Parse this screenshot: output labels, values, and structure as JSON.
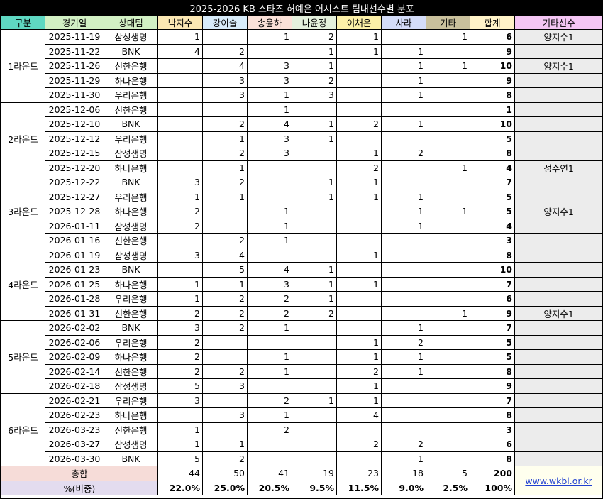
{
  "title": "2025-2026 KB 스타즈 허예은 어시스트 팀내선수별 분포",
  "headers": [
    {
      "label": "구분",
      "bg": "#5fd8c2"
    },
    {
      "label": "경기일",
      "bg": "#d2f0c4"
    },
    {
      "label": "상대팀",
      "bg": "#d2f0c4"
    },
    {
      "label": "박지수",
      "bg": "#fbe7b3"
    },
    {
      "label": "강이슬",
      "bg": "#d8ecfa"
    },
    {
      "label": "송윤하",
      "bg": "#fbe1d8"
    },
    {
      "label": "나윤정",
      "bg": "#e4f0dc"
    },
    {
      "label": "이채은",
      "bg": "#fcf0a8"
    },
    {
      "label": "사라",
      "bg": "#d4dcf8"
    },
    {
      "label": "기타",
      "bg": "#c9c09c"
    },
    {
      "label": "합계",
      "bg": "#fff3c8"
    },
    {
      "label": "기타선수",
      "bg": "#f4c6f4"
    }
  ],
  "rounds": [
    {
      "label": "1라운드",
      "games": [
        {
          "date": "2025-11-19",
          "opp": "삼성생명",
          "v": [
            "1",
            "",
            "1",
            "2",
            "1",
            "",
            "1"
          ],
          "total": "6",
          "other": "양지수1"
        },
        {
          "date": "2025-11-22",
          "opp": "BNK",
          "v": [
            "4",
            "2",
            "",
            "1",
            "1",
            "1",
            ""
          ],
          "total": "9",
          "other": ""
        },
        {
          "date": "2025-11-26",
          "opp": "신한은행",
          "v": [
            "",
            "4",
            "3",
            "1",
            "",
            "1",
            "1"
          ],
          "total": "10",
          "other": "양지수1"
        },
        {
          "date": "2025-11-29",
          "opp": "하나은행",
          "v": [
            "",
            "3",
            "3",
            "2",
            "",
            "1",
            ""
          ],
          "total": "9",
          "other": ""
        },
        {
          "date": "2025-11-30",
          "opp": "우리은행",
          "v": [
            "",
            "3",
            "1",
            "3",
            "",
            "1",
            ""
          ],
          "total": "8",
          "other": ""
        }
      ]
    },
    {
      "label": "2라운드",
      "games": [
        {
          "date": "2025-12-06",
          "opp": "신한은행",
          "v": [
            "",
            "",
            "1",
            "",
            "",
            "",
            ""
          ],
          "total": "1",
          "other": ""
        },
        {
          "date": "2025-12-10",
          "opp": "BNK",
          "v": [
            "",
            "2",
            "4",
            "1",
            "2",
            "1",
            ""
          ],
          "total": "10",
          "other": ""
        },
        {
          "date": "2025-12-12",
          "opp": "우리은행",
          "v": [
            "",
            "1",
            "3",
            "1",
            "",
            "",
            ""
          ],
          "total": "5",
          "other": ""
        },
        {
          "date": "2025-12-15",
          "opp": "삼성생명",
          "v": [
            "",
            "2",
            "3",
            "",
            "1",
            "2",
            ""
          ],
          "total": "8",
          "other": ""
        },
        {
          "date": "2025-12-20",
          "opp": "하나은행",
          "v": [
            "",
            "1",
            "",
            "",
            "2",
            "",
            "1"
          ],
          "total": "4",
          "other": "성수연1"
        }
      ]
    },
    {
      "label": "3라운드",
      "games": [
        {
          "date": "2025-12-22",
          "opp": "BNK",
          "v": [
            "3",
            "2",
            "",
            "1",
            "1",
            "",
            ""
          ],
          "total": "7",
          "other": ""
        },
        {
          "date": "2025-12-27",
          "opp": "우리은행",
          "v": [
            "1",
            "1",
            "",
            "1",
            "1",
            "1",
            ""
          ],
          "total": "5",
          "other": ""
        },
        {
          "date": "2025-12-28",
          "opp": "하나은행",
          "v": [
            "2",
            "",
            "1",
            "",
            "",
            "1",
            "1"
          ],
          "total": "5",
          "other": "양지수1"
        },
        {
          "date": "2026-01-11",
          "opp": "삼성생명",
          "v": [
            "2",
            "",
            "1",
            "",
            "",
            "1",
            ""
          ],
          "total": "4",
          "other": ""
        },
        {
          "date": "2026-01-16",
          "opp": "신한은행",
          "v": [
            "",
            "2",
            "1",
            "",
            "",
            "",
            ""
          ],
          "total": "3",
          "other": ""
        }
      ]
    },
    {
      "label": "4라운드",
      "games": [
        {
          "date": "2026-01-19",
          "opp": "삼성생명",
          "v": [
            "3",
            "4",
            "",
            "",
            "1",
            "",
            ""
          ],
          "total": "8",
          "other": ""
        },
        {
          "date": "2026-01-23",
          "opp": "BNK",
          "v": [
            "",
            "5",
            "4",
            "1",
            "",
            "",
            ""
          ],
          "total": "10",
          "other": ""
        },
        {
          "date": "2026-01-25",
          "opp": "하나은행",
          "v": [
            "1",
            "1",
            "3",
            "1",
            "1",
            "",
            ""
          ],
          "total": "7",
          "other": ""
        },
        {
          "date": "2026-01-28",
          "opp": "우리은행",
          "v": [
            "1",
            "2",
            "2",
            "1",
            "",
            "",
            ""
          ],
          "total": "6",
          "other": ""
        },
        {
          "date": "2026-01-31",
          "opp": "신한은행",
          "v": [
            "2",
            "2",
            "2",
            "2",
            "",
            "",
            "1"
          ],
          "total": "9",
          "other": "양지수1"
        }
      ]
    },
    {
      "label": "5라운드",
      "games": [
        {
          "date": "2026-02-02",
          "opp": "BNK",
          "v": [
            "3",
            "2",
            "1",
            "",
            "",
            "1",
            ""
          ],
          "total": "7",
          "other": ""
        },
        {
          "date": "2026-02-06",
          "opp": "우리은행",
          "v": [
            "2",
            "",
            "",
            "",
            "1",
            "2",
            ""
          ],
          "total": "5",
          "other": ""
        },
        {
          "date": "2026-02-09",
          "opp": "하나은행",
          "v": [
            "2",
            "",
            "1",
            "",
            "1",
            "1",
            ""
          ],
          "total": "5",
          "other": ""
        },
        {
          "date": "2026-02-14",
          "opp": "신한은행",
          "v": [
            "2",
            "2",
            "1",
            "",
            "2",
            "1",
            ""
          ],
          "total": "8",
          "other": ""
        },
        {
          "date": "2026-02-18",
          "opp": "삼성생명",
          "v": [
            "5",
            "3",
            "",
            "",
            "1",
            "",
            ""
          ],
          "total": "9",
          "other": ""
        }
      ]
    },
    {
      "label": "6라운드",
      "games": [
        {
          "date": "2026-02-21",
          "opp": "우리은행",
          "v": [
            "3",
            "",
            "2",
            "1",
            "1",
            "",
            ""
          ],
          "total": "7",
          "other": ""
        },
        {
          "date": "2026-02-23",
          "opp": "하나은행",
          "v": [
            "",
            "3",
            "1",
            "",
            "4",
            "",
            ""
          ],
          "total": "8",
          "other": ""
        },
        {
          "date": "2026-03-23",
          "opp": "신한은행",
          "v": [
            "1",
            "",
            "2",
            "",
            "",
            "",
            ""
          ],
          "total": "3",
          "other": ""
        },
        {
          "date": "2026-03-27",
          "opp": "삼성생명",
          "v": [
            "1",
            "1",
            "",
            "",
            "2",
            "2",
            ""
          ],
          "total": "6",
          "other": ""
        },
        {
          "date": "2026-03-30",
          "opp": "BNK",
          "v": [
            "5",
            "2",
            "",
            "",
            "",
            "1",
            ""
          ],
          "total": "8",
          "other": ""
        }
      ]
    }
  ],
  "summary": {
    "total_label": "총합",
    "totals": [
      "44",
      "50",
      "41",
      "19",
      "23",
      "18",
      "5"
    ],
    "grand_total": "200",
    "pct_label": "%(비중)",
    "pcts": [
      "22.0%",
      "25.0%",
      "20.5%",
      "9.5%",
      "11.5%",
      "9.0%",
      "2.5%"
    ],
    "grand_pct": "100%",
    "link": "www.wkbl.or.kr"
  }
}
